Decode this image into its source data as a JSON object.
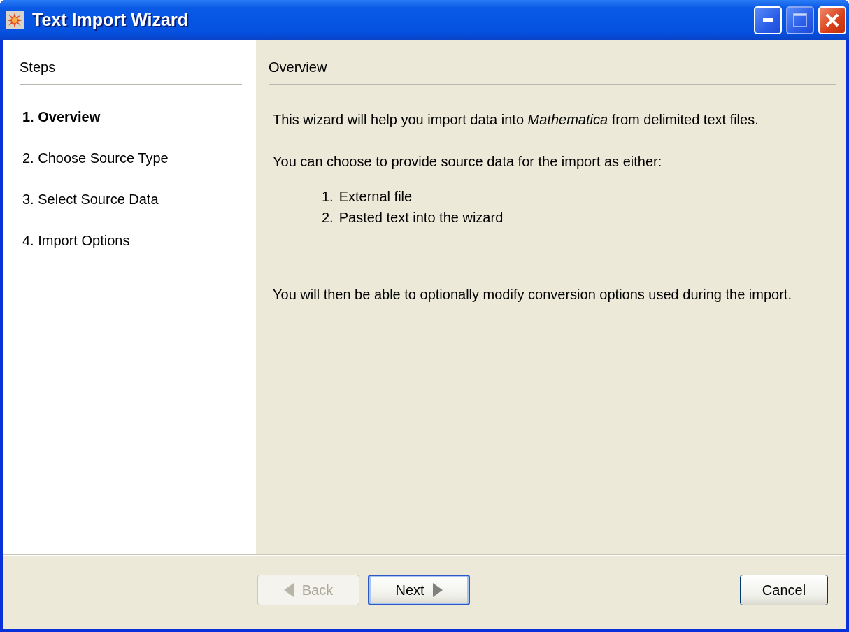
{
  "window": {
    "title": "Text Import Wizard",
    "controls": [
      {
        "kind": "minimize",
        "disabled": false
      },
      {
        "kind": "maximize",
        "disabled": true
      },
      {
        "kind": "close",
        "disabled": false
      }
    ]
  },
  "steps": {
    "heading": "Steps",
    "items": [
      {
        "label": "1. Overview",
        "selected": true
      },
      {
        "label": "2. Choose Source Type",
        "selected": false
      },
      {
        "label": "3. Select Source Data",
        "selected": false
      },
      {
        "label": "4. Import Options",
        "selected": false
      }
    ]
  },
  "content": {
    "heading": "Overview",
    "blocks": [
      {
        "kind": "paragraph",
        "text": "This wizard will help you import data into *Mathematica* from delimited text files."
      },
      {
        "kind": "paragraph",
        "text": "You can choose to provide source data for the import as either:"
      },
      {
        "kind": "list",
        "items": [
          {
            "marker": "1.",
            "text": "External file"
          },
          {
            "marker": "2.",
            "text": "Pasted text into the wizard"
          }
        ]
      },
      {
        "kind": "paragraph",
        "text": "You will then be able to optionally modify conversion options used during the import."
      }
    ]
  },
  "buttons": [
    {
      "label": "Back",
      "kind": "back",
      "disabled": true,
      "default": false
    },
    {
      "label": "Next",
      "kind": "next",
      "disabled": false,
      "default": true
    },
    {
      "label": "Cancel",
      "kind": "cancel",
      "disabled": false,
      "default": false
    }
  ]
}
